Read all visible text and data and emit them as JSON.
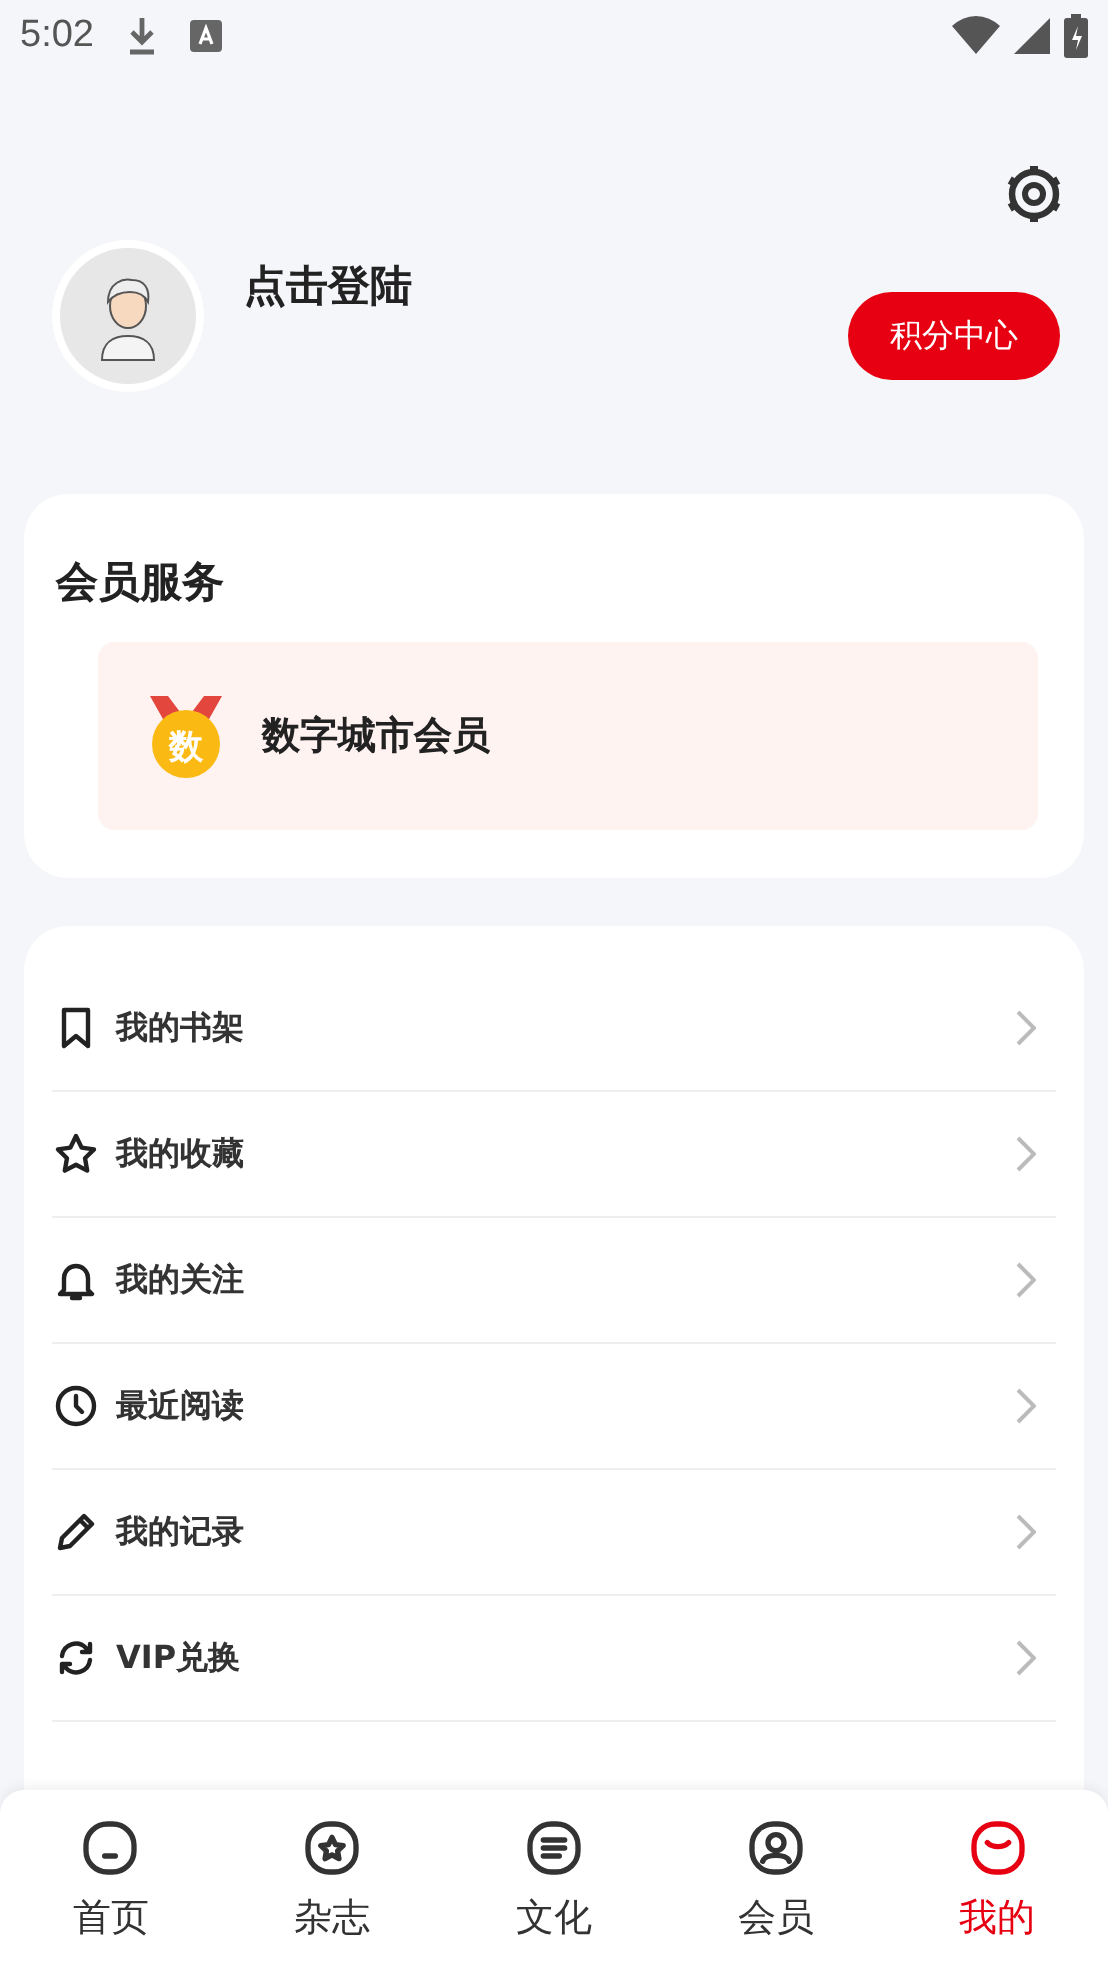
{
  "status_bar": {
    "time": "5:02"
  },
  "profile": {
    "name": "点击登陆",
    "points_button": "积分中心"
  },
  "membership": {
    "title": "会员服务",
    "item": {
      "badge": "数",
      "label": "数字城市会员"
    }
  },
  "menu": [
    {
      "kind": "bookmark",
      "label": "我的书架"
    },
    {
      "kind": "star",
      "label": "我的收藏"
    },
    {
      "kind": "bell",
      "label": "我的关注"
    },
    {
      "kind": "clock",
      "label": "最近阅读"
    },
    {
      "kind": "pencil",
      "label": "我的记录"
    },
    {
      "kind": "exchange",
      "label": "VIP兑换"
    }
  ],
  "tabs": [
    {
      "kind": "home",
      "label": "首页",
      "selected": false
    },
    {
      "kind": "magazine",
      "label": "杂志",
      "selected": false
    },
    {
      "kind": "culture",
      "label": "文化",
      "selected": false
    },
    {
      "kind": "member",
      "label": "会员",
      "selected": false
    },
    {
      "kind": "mine",
      "label": "我的",
      "selected": true
    }
  ]
}
